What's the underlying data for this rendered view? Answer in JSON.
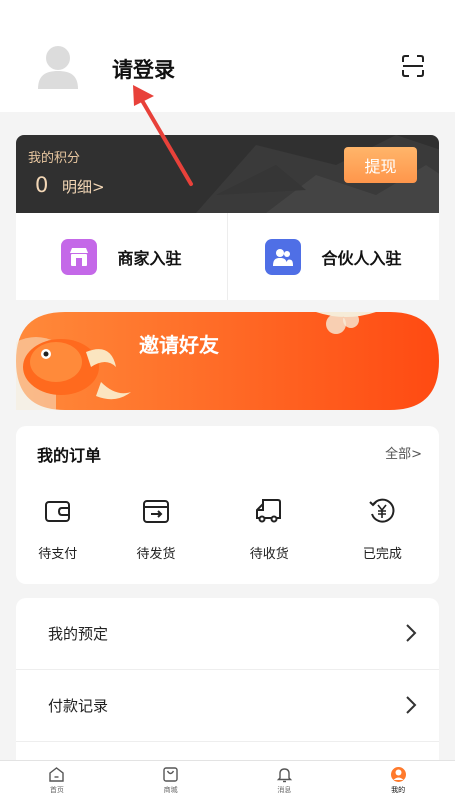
{
  "header": {
    "login_label": "请登录"
  },
  "points": {
    "title": "我的积分",
    "value": "0",
    "detail_label": "明细>",
    "withdraw_label": "提现"
  },
  "join": {
    "merchant_label": "商家入驻",
    "partner_label": "合伙人入驻"
  },
  "invite": {
    "label": "邀请好友"
  },
  "orders": {
    "title": "我的订单",
    "all_label": "全部>",
    "items": [
      {
        "label": "待支付",
        "icon": "wallet-icon"
      },
      {
        "label": "待发货",
        "icon": "ship-out-icon"
      },
      {
        "label": "待收货",
        "icon": "truck-icon"
      },
      {
        "label": "已完成",
        "icon": "yen-refresh-icon"
      }
    ]
  },
  "menu": {
    "items": [
      {
        "label": "我的预定"
      },
      {
        "label": "付款记录"
      }
    ]
  },
  "bottom_nav": {
    "items": [
      {
        "label": "首页",
        "icon": "home-icon"
      },
      {
        "label": "商城",
        "icon": "shop-bag-icon"
      },
      {
        "label": "消息",
        "icon": "bell-icon"
      },
      {
        "label": "我的",
        "icon": "user-icon",
        "active": true
      }
    ]
  },
  "colors": {
    "accent_orange": "#ff7a2c",
    "merchant_icon_bg": "#c468e8",
    "partner_icon_bg": "#4f6fe6",
    "points_card_bg": "#303030",
    "annotation_arrow": "#e8413a"
  }
}
